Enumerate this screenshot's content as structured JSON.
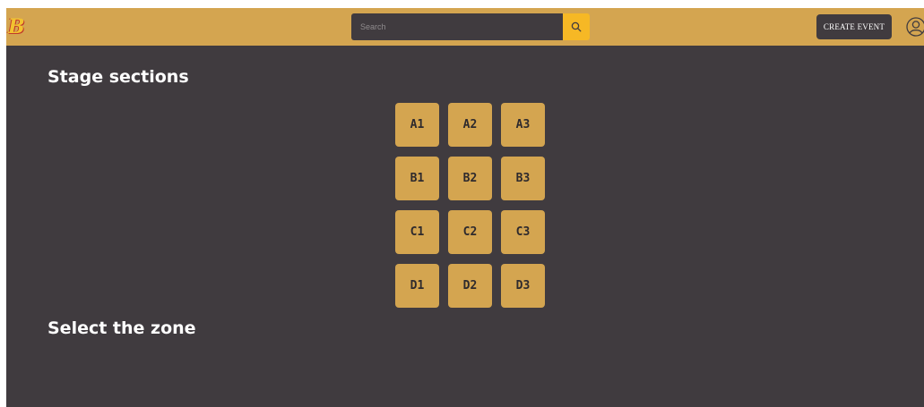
{
  "header": {
    "logo_text": "B",
    "search": {
      "placeholder": "Search",
      "value": ""
    },
    "search_icon": "search-icon",
    "create_event_label": "CREATE EVENT",
    "avatar_icon": "user-avatar-icon",
    "colors": {
      "bar": "#d4a550",
      "search_button": "#f6b825",
      "dark": "#403b3f"
    }
  },
  "main": {
    "stage_title": "Stage sections",
    "zone_title": "Select the zone",
    "sections": [
      "A1",
      "A2",
      "A3",
      "B1",
      "B2",
      "B3",
      "C1",
      "C2",
      "C3",
      "D1",
      "D2",
      "D3"
    ],
    "colors": {
      "background": "#403b3f",
      "section": "#d4a550"
    }
  }
}
